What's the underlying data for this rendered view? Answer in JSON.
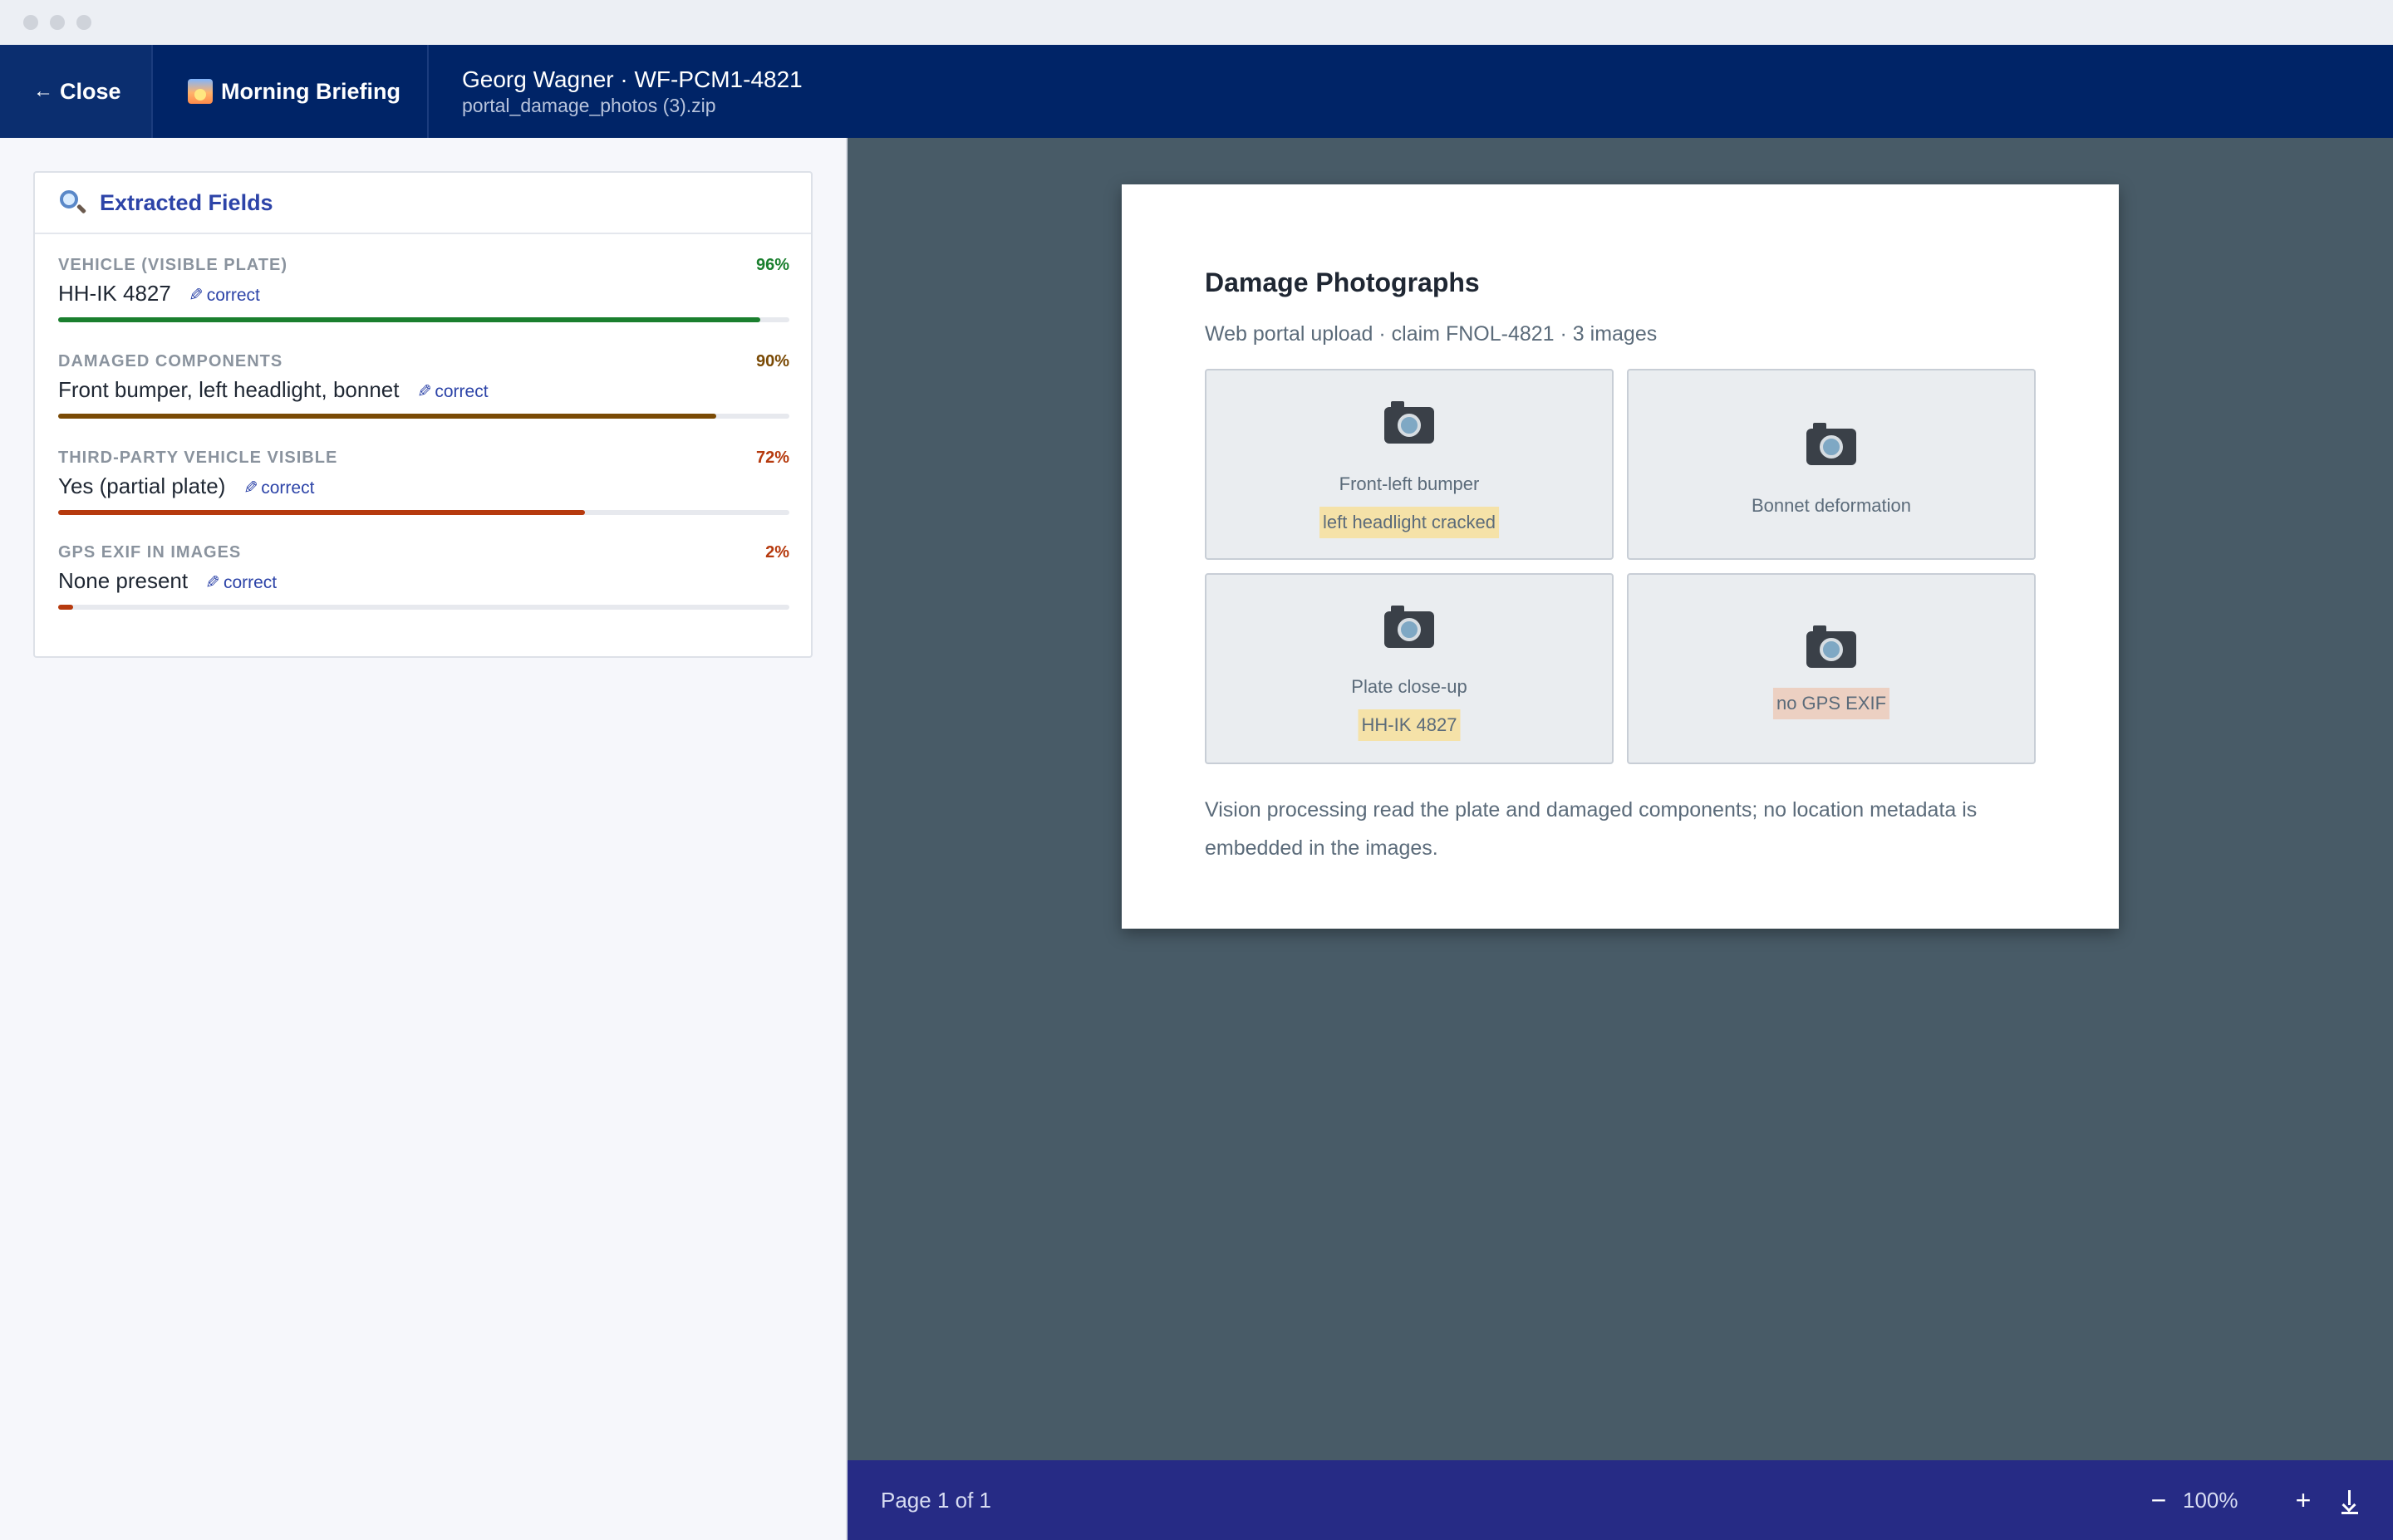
{
  "header": {
    "close_label": "Close",
    "briefing_label": "Morning Briefing",
    "title": "Georg Wagner · WF-PCM1-4821",
    "subtitle": "portal_damage_photos (3).zip"
  },
  "extracted": {
    "title": "Extracted Fields",
    "correct_label": "correct",
    "fields": [
      {
        "label": "VEHICLE (VISIBLE PLATE)",
        "value": "HH-IK 4827",
        "confidence": "96%",
        "confidence_value": 0.96,
        "color": "#1a7f2e"
      },
      {
        "label": "DAMAGED COMPONENTS",
        "value": "Front bumper, left headlight, bonnet",
        "confidence": "90%",
        "confidence_value": 0.9,
        "color": "#7a4a05"
      },
      {
        "label": "THIRD-PARTY VEHICLE VISIBLE",
        "value": "Yes (partial plate)",
        "confidence": "72%",
        "confidence_value": 0.72,
        "color": "#b63a0e"
      },
      {
        "label": "GPS EXIF IN IMAGES",
        "value": "None present",
        "confidence": "2%",
        "confidence_value": 0.02,
        "color": "#b63a0e"
      }
    ]
  },
  "document": {
    "title": "Damage Photographs",
    "subtitle": "Web portal upload · claim FNOL-4821 · 3 images",
    "photos": [
      {
        "caption": "Front-left bumper",
        "tag": "left headlight cracked",
        "tag_color": "#f5e2a8"
      },
      {
        "caption": "Bonnet deformation",
        "tag": ""
      },
      {
        "caption": "Plate close-up",
        "tag": "HH-IK 4827",
        "tag_color": "#f5e2a8"
      },
      {
        "caption": "",
        "tag": "no GPS EXIF",
        "tag_color": "#ecd0c2"
      }
    ],
    "note": "Vision processing read the plate and damaged components; no location metadata is embedded in the images."
  },
  "viewer": {
    "page_indicator": "Page 1 of 1",
    "zoom_out": "−",
    "zoom_level": "100%",
    "zoom_in": "+"
  },
  "icons": {
    "close": "arrow-left-icon",
    "briefing": "sunrise-icon",
    "extracted": "magnifier-icon",
    "photo": "camera-icon",
    "edit": "pencil-icon",
    "download": "download-icon"
  },
  "colors": {
    "header_bg": "#002467",
    "accent": "#2d44a8",
    "viewer_bg": "#485b67",
    "bottom_bar": "#262b85"
  }
}
